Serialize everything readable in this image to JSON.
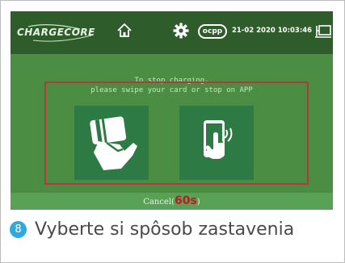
{
  "header": {
    "logo_text": "CHARGECORE",
    "ocpp_label": "ocpp",
    "datetime": "21-02 2020  10:03:46"
  },
  "main": {
    "instruction_line1": "To stop charging,",
    "instruction_line2": "please swipe your card or stop on APP",
    "options": [
      {
        "name": "swipe-card",
        "icon": "card-in-hand-icon"
      },
      {
        "name": "stop-on-app",
        "icon": "phone-tap-icon"
      }
    ]
  },
  "footer": {
    "cancel_prefix": "Cancel(",
    "countdown": "60s",
    "cancel_suffix": ")"
  },
  "caption": {
    "step_number": "8",
    "text": "Vyberte si spôsob zastavenia"
  },
  "colors": {
    "screen_bg": "#4c8d44",
    "header_bg": "#2e5d2b",
    "tile_bg": "#2e7a44",
    "highlight_border": "#b3393e",
    "countdown": "#c2182a",
    "step_badge": "#33a8dd"
  }
}
